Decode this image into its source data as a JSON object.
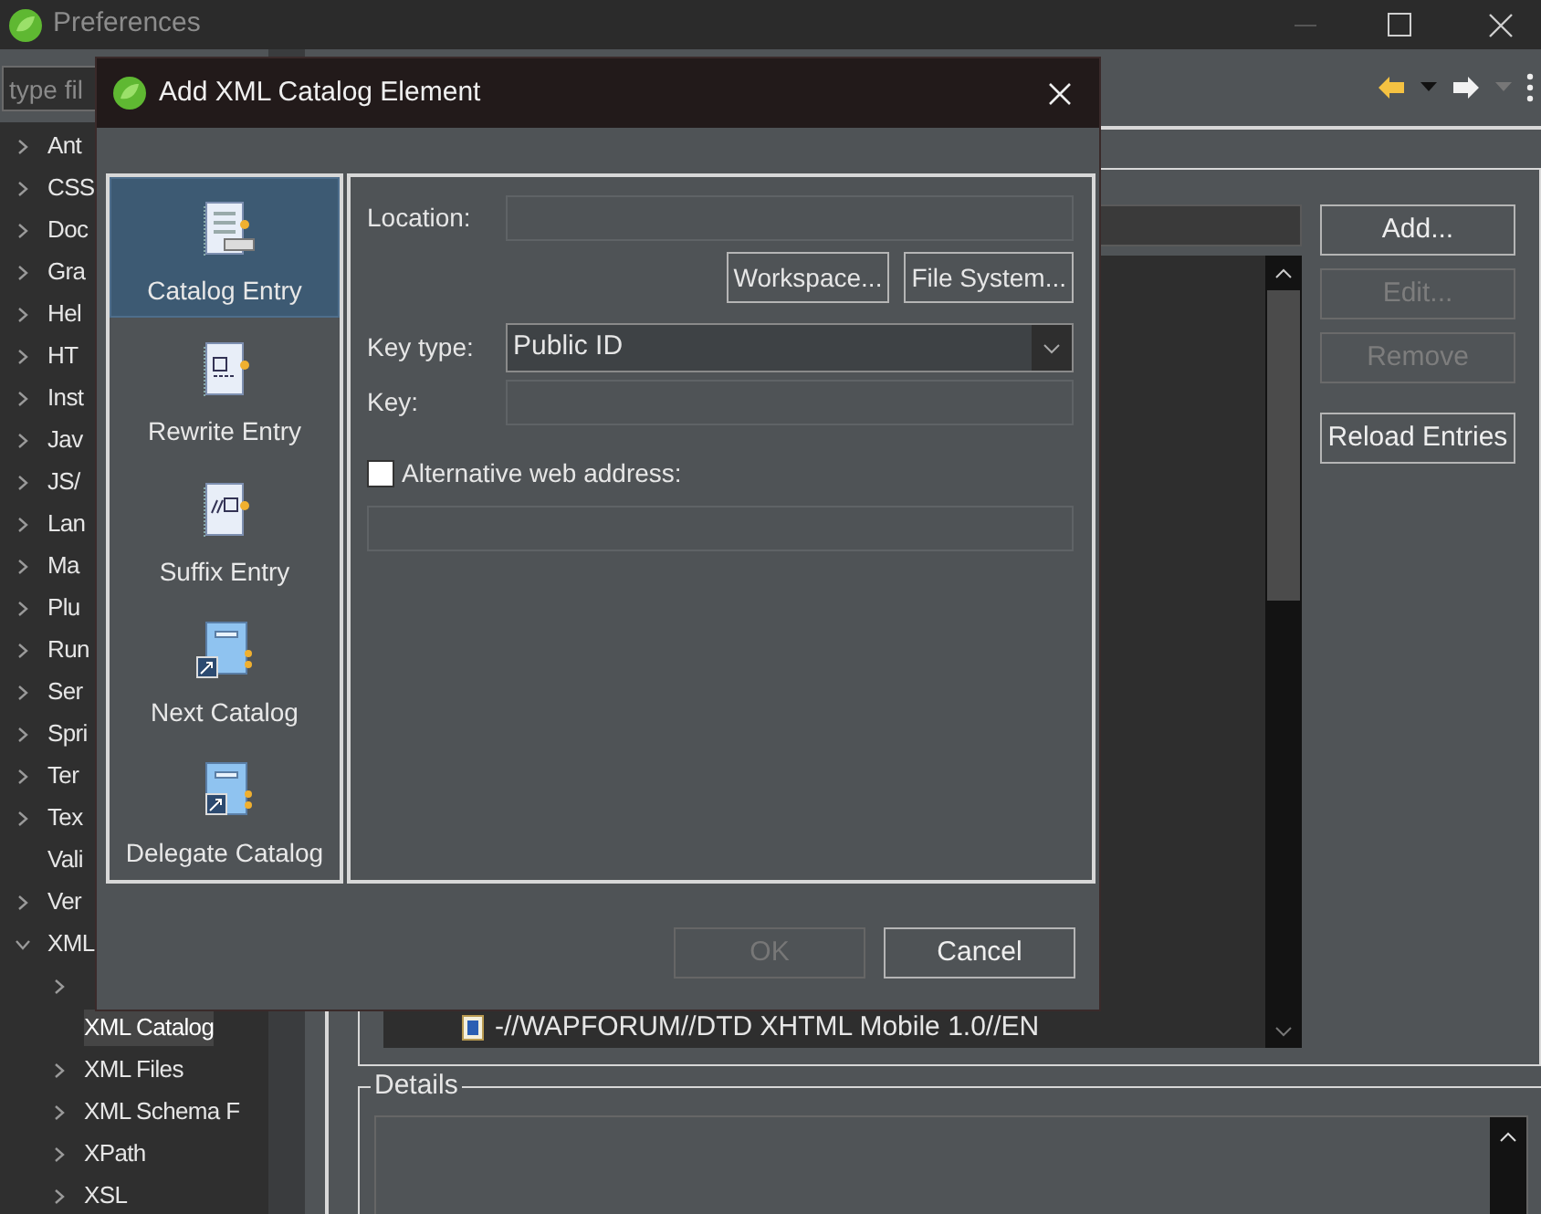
{
  "window": {
    "title": "Preferences"
  },
  "sidebar": {
    "filter_placeholder": "type fil",
    "items": [
      {
        "label": "Ant",
        "expandable": true,
        "expanded": false,
        "selected": false
      },
      {
        "label": "CSS",
        "expandable": true,
        "expanded": false,
        "selected": false
      },
      {
        "label": "Doc",
        "expandable": true,
        "expanded": false,
        "selected": false
      },
      {
        "label": "Gra",
        "expandable": true,
        "expanded": false,
        "selected": false
      },
      {
        "label": "Hel",
        "expandable": true,
        "expanded": false,
        "selected": false
      },
      {
        "label": "HT",
        "expandable": true,
        "expanded": false,
        "selected": false
      },
      {
        "label": "Inst",
        "expandable": true,
        "expanded": false,
        "selected": false
      },
      {
        "label": "Jav",
        "expandable": true,
        "expanded": false,
        "selected": false
      },
      {
        "label": "JS/",
        "expandable": true,
        "expanded": false,
        "selected": false
      },
      {
        "label": "Lan",
        "expandable": true,
        "expanded": false,
        "selected": false
      },
      {
        "label": "Ma",
        "expandable": true,
        "expanded": false,
        "selected": false
      },
      {
        "label": "Plu",
        "expandable": true,
        "expanded": false,
        "selected": false
      },
      {
        "label": "Run",
        "expandable": true,
        "expanded": false,
        "selected": false
      },
      {
        "label": "Ser",
        "expandable": true,
        "expanded": false,
        "selected": false
      },
      {
        "label": "Spri",
        "expandable": true,
        "expanded": false,
        "selected": false
      },
      {
        "label": "Ter",
        "expandable": true,
        "expanded": false,
        "selected": false
      },
      {
        "label": "Tex",
        "expandable": true,
        "expanded": false,
        "selected": false
      },
      {
        "label": "Vali",
        "expandable": false,
        "selected": false
      },
      {
        "label": "Ver",
        "expandable": true,
        "expanded": false,
        "selected": false
      },
      {
        "label": "XML",
        "expandable": true,
        "expanded": true,
        "selected": false,
        "children": [
          {
            "expandable": true,
            "expanded": false
          },
          {
            "label": "XML Catalog",
            "expandable": false,
            "selected": true
          },
          {
            "label": "XML Files",
            "expandable": true,
            "expanded": false,
            "selected": false
          },
          {
            "label": "XML Schema F",
            "expandable": true,
            "expanded": false,
            "selected": false
          },
          {
            "label": "XPath",
            "expandable": true,
            "expanded": false,
            "selected": false
          },
          {
            "label": "XSL",
            "expandable": true,
            "expanded": false,
            "selected": false
          }
        ]
      }
    ]
  },
  "catalog_page": {
    "entries": [
      "-//WAPFORUM//DTD XHTML Mobile 1.0//EN"
    ],
    "buttons": [
      {
        "label": "Add...",
        "disabled": false
      },
      {
        "label": "Edit...",
        "disabled": true
      },
      {
        "label": "Remove",
        "disabled": true
      },
      {
        "label": "Reload Entries",
        "disabled": false
      }
    ],
    "details": {
      "title": "Details"
    }
  },
  "dialog": {
    "title": "Add XML Catalog Element",
    "element_types": [
      {
        "label": "Catalog Entry",
        "selected": true,
        "kind": "entry"
      },
      {
        "label": "Rewrite Entry",
        "selected": false,
        "kind": "rewrite"
      },
      {
        "label": "Suffix Entry",
        "selected": false,
        "kind": "suffix"
      },
      {
        "label": "Next Catalog",
        "selected": false,
        "kind": "next"
      },
      {
        "label": "Delegate Catalog",
        "selected": false,
        "kind": "delegate"
      }
    ],
    "location": {
      "label": "Location:"
    },
    "browse_buttons": [
      {
        "label": "Workspace..."
      },
      {
        "label": "File System..."
      }
    ],
    "key_type": {
      "label": "Key type:",
      "value": "Public ID"
    },
    "key": {
      "label": "Key:"
    },
    "alternative": {
      "label": "Alternative web address:",
      "checked": false
    },
    "buttons": [
      {
        "label": "OK",
        "disabled": true
      },
      {
        "label": "Cancel",
        "disabled": false
      }
    ]
  }
}
